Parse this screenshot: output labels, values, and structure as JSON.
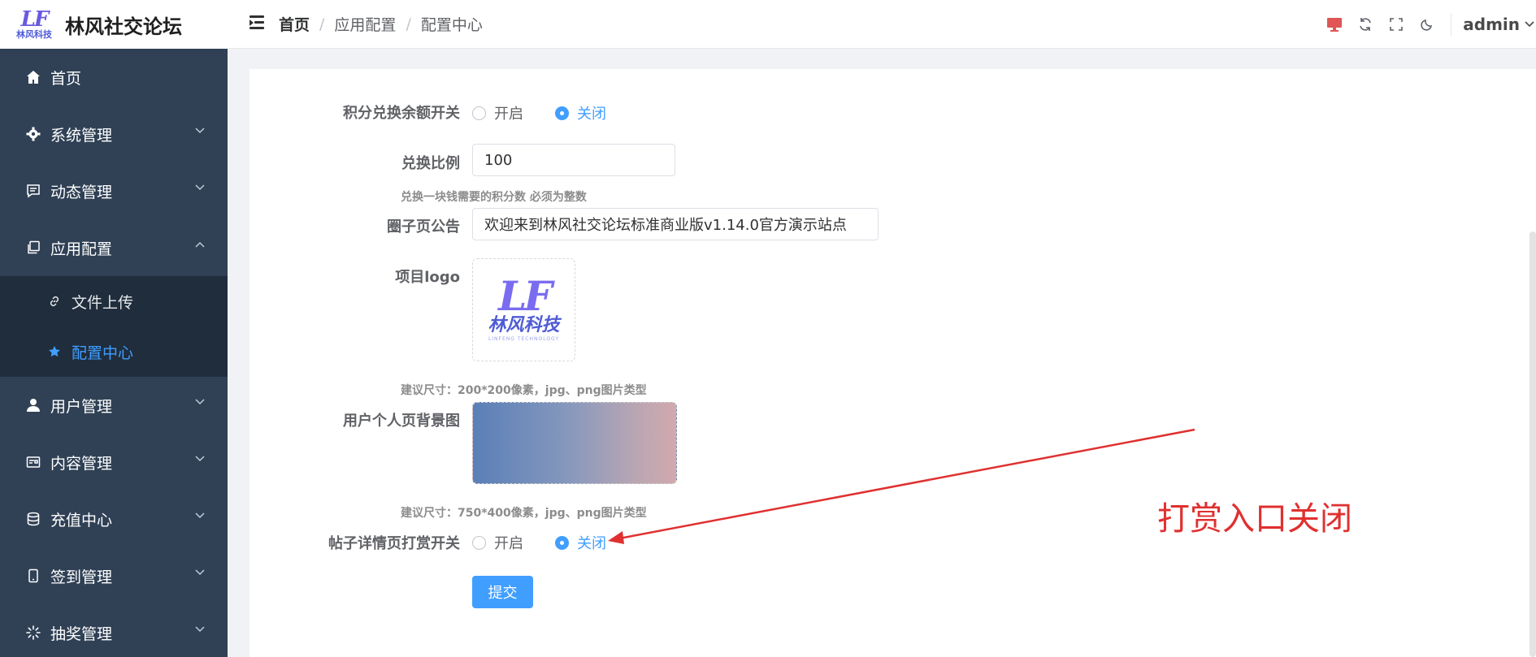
{
  "brand": {
    "logo_text": "LF",
    "logo_sub": "林风科技",
    "name": "林风社交论坛"
  },
  "breadcrumb": [
    "首页",
    "应用配置",
    "配置中心"
  ],
  "user": {
    "name": "admin"
  },
  "sidebar": {
    "items": [
      {
        "label": "首页",
        "icon": "home-icon"
      },
      {
        "label": "系统管理",
        "icon": "gear-icon"
      },
      {
        "label": "动态管理",
        "icon": "message-icon"
      },
      {
        "label": "应用配置",
        "icon": "copy-icon",
        "expanded": true,
        "children": [
          {
            "label": "文件上传",
            "icon": "link-icon"
          },
          {
            "label": "配置中心",
            "icon": "star-icon",
            "active": true
          }
        ]
      },
      {
        "label": "用户管理",
        "icon": "user-icon"
      },
      {
        "label": "内容管理",
        "icon": "card-icon"
      },
      {
        "label": "充值中心",
        "icon": "database-icon"
      },
      {
        "label": "签到管理",
        "icon": "phone-icon"
      },
      {
        "label": "抽奖管理",
        "icon": "loading-icon"
      }
    ]
  },
  "form": {
    "exchange_switch": {
      "label": "积分兑换余额开关",
      "options": [
        "开启",
        "关闭"
      ],
      "selected": "关闭"
    },
    "exchange_ratio": {
      "label": "兑换比例",
      "value": "100",
      "hint": "兑换一块钱需要的积分数 必须为整数"
    },
    "circle_notice": {
      "label": "圈子页公告",
      "value": "欢迎来到林风社交论坛标准商业版v1.14.0官方演示站点"
    },
    "project_logo": {
      "label": "项目logo",
      "logo_big": "LF",
      "logo_cn": "林风科技",
      "logo_en": "LINFENG TECHNOLOGY",
      "hint": "建议尺寸：200*200像素，jpg、png图片类型"
    },
    "user_bg": {
      "label": "用户个人页背景图",
      "hint": "建议尺寸：750*400像素，jpg、png图片类型"
    },
    "reward_switch": {
      "label": "帖子详情页打赏开关",
      "options": [
        "开启",
        "关闭"
      ],
      "selected": "关闭"
    },
    "submit_label": "提交"
  },
  "annotation": {
    "text": "打赏入口关闭",
    "color": "#e03030"
  },
  "colors": {
    "sidebar_bg": "#304156",
    "sidebar_sub_bg": "#1f2d3d",
    "primary": "#409eff",
    "screen_icon": "#e05555"
  }
}
